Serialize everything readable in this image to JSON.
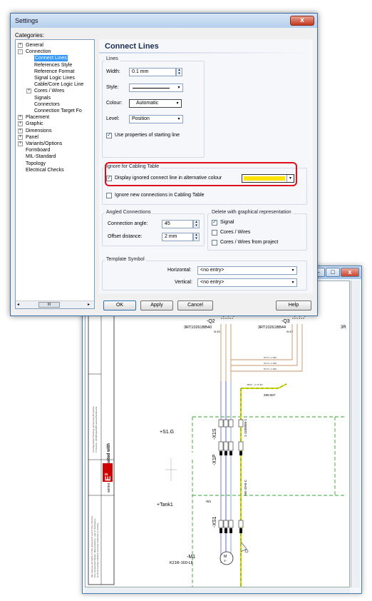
{
  "dialog": {
    "title": "Settings",
    "close": "x",
    "categories_label": "Categories:",
    "panel_title": "Connect Lines",
    "buttons": {
      "ok": "OK",
      "apply": "Apply",
      "cancel": "Cancel",
      "help": "Help"
    }
  },
  "tree": {
    "items": [
      {
        "label": "General",
        "level": 0,
        "expander": "+"
      },
      {
        "label": "Connection",
        "level": 0,
        "expander": "-"
      },
      {
        "label": "Connect Lines",
        "level": 1,
        "selected": true
      },
      {
        "label": "References Style",
        "level": 1
      },
      {
        "label": "Reference Format",
        "level": 1
      },
      {
        "label": "Signal Logic Lines",
        "level": 1
      },
      {
        "label": "Cable/Core Logic Line",
        "level": 1
      },
      {
        "label": "Cores / Wires",
        "level": 1,
        "expander": "+"
      },
      {
        "label": "Signals",
        "level": 1
      },
      {
        "label": "Connectors",
        "level": 1
      },
      {
        "label": "Connection Target Fo",
        "level": 1
      },
      {
        "label": "Placement",
        "level": 0,
        "expander": "+"
      },
      {
        "label": "Graphic",
        "level": 0,
        "expander": "+"
      },
      {
        "label": "Dimensions",
        "level": 0,
        "expander": "+"
      },
      {
        "label": "Panel",
        "level": 0,
        "expander": "+"
      },
      {
        "label": "Variants/Options",
        "level": 0,
        "expander": "+"
      },
      {
        "label": "Formboard",
        "level": 0
      },
      {
        "label": "MIL-Standard",
        "level": 0
      },
      {
        "label": "Topology",
        "level": 0
      },
      {
        "label": "Electrical Checks",
        "level": 0
      }
    ],
    "scroll_thumb": "III"
  },
  "lines": {
    "group": "Lines",
    "width_label": "Width:",
    "width_value": "0.1 mm",
    "style_label": "Style:",
    "style_value": "",
    "colour_label": "Colour:",
    "colour_value": "Automatic",
    "level_label": "Level:",
    "level_value": "Position",
    "use_props_label": "Use properties of starting line",
    "use_props_checked": true
  },
  "ignore": {
    "group": "Ignore for Cabling Table",
    "display_label": "Display ignored connect line in alternative colour",
    "display_checked": true,
    "colour": "#ffe400",
    "ignore_new_label": "Ignore new connections in Cabling Table",
    "ignore_new_checked": false
  },
  "angled": {
    "group": "Angled Connections",
    "angle_label": "Connection angle:",
    "angle_value": "45",
    "offset_label": "Offset distance:",
    "offset_value": "2 mm"
  },
  "delete": {
    "group": "Delete with graphical representation",
    "signal_label": "Signal",
    "signal_checked": true,
    "cores_label": "Cores / Wires",
    "cores_checked": false,
    "cores_project_label": "Cores / Wires from project",
    "cores_project_checked": false
  },
  "template": {
    "group": "Template Symbol",
    "horizontal_label": "Horizontal:",
    "horizontal_value": "<no entry>",
    "vertical_label": "Vertical:",
    "vertical_value": "<no entry>"
  },
  "schematic": {
    "labels": {
      "q2": "-Q2",
      "q2_type": "3RT10261BB40",
      "q2_sub": "/5.E2",
      "q3": "-Q3",
      "q3_type": "3RT10261BB44",
      "q3_sub": "/5.E2",
      "r_edge": "3R",
      "s1g": "+S1.G",
      "tank1": "+Tank1",
      "x1s": "-X1S",
      "x1p": "-X1P",
      "xs1": "-XS1",
      "m1": "-M1",
      "motor_type": "K21R-160-L8",
      "w1": "-W1",
      "cable_a": "1-1100086-1",
      "cable_b": "HE-10-B-C",
      "sig_label": "280-807",
      "brand": "created with",
      "brand_mark": "E³",
      "brand_sub": "series"
    }
  }
}
